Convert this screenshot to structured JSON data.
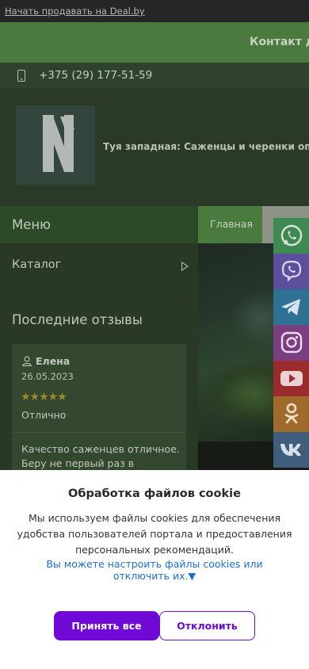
{
  "topbar": {
    "sell_link": "Начать продавать на Deal.by"
  },
  "greenbar": {
    "contact_label": "Контакт д"
  },
  "phonebar": {
    "phone": "+375 (29) 177-51-59"
  },
  "header": {
    "site_title": "Туя западная: Саженцы и черенки опт"
  },
  "sidebar": {
    "menu_title": "Меню",
    "catalog_label": "Каталог",
    "reviews_title": "Последние отзывы",
    "review": {
      "author": "Елена",
      "date": "26.05.2023",
      "rating": 5,
      "stars": "★★★★★",
      "rating_text": "Отлично",
      "text": "Качество саженцев отличное. Беру не первый раз в"
    }
  },
  "nav": {
    "home_tab": "Главная"
  },
  "social": [
    {
      "name": "whatsapp",
      "icon": "whatsapp-icon",
      "color": "#25d366"
    },
    {
      "name": "viber",
      "icon": "viber-icon",
      "color": "#7360f2"
    },
    {
      "name": "telegram",
      "icon": "telegram-icon",
      "color": "#2ca5e0"
    },
    {
      "name": "instagram",
      "icon": "instagram-icon",
      "color": "#c13584"
    },
    {
      "name": "youtube",
      "icon": "youtube-icon",
      "color": "#ff0000"
    },
    {
      "name": "odnoklassniki",
      "icon": "odnoklassniki-icon",
      "color": "#ee8208"
    },
    {
      "name": "vkontakte",
      "icon": "vk-icon",
      "color": "#4c75a3"
    }
  ],
  "cookie": {
    "title": "Обработка файлов cookie",
    "text": "Мы используем файлы cookies для обеспечения удобства пользователей портала и предоставления персональных рекомендаций.",
    "settings_link": "Вы можете настроить файлы cookies или отключить их.▼",
    "accept_label": "Принять все",
    "decline_label": "Отклонить",
    "accent_color": "#7009d6"
  }
}
